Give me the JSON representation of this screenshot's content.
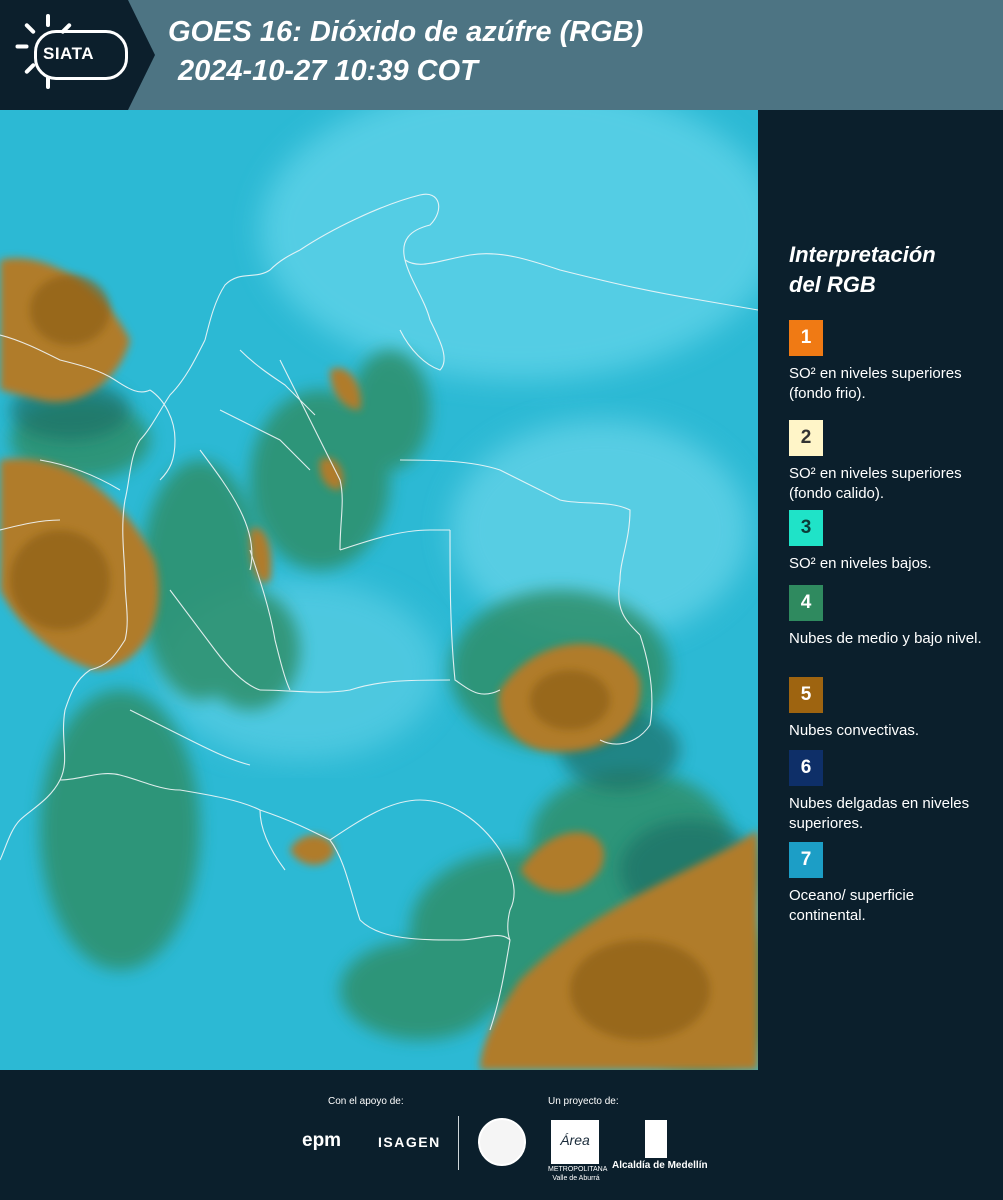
{
  "header": {
    "logo_text": "SIATA",
    "title_line1": "GOES 16: Dióxido de azúfre (RGB)",
    "title_line2": "2024-10-27 10:39 COT"
  },
  "map": {
    "region": "Colombia",
    "icon": "satellite-image"
  },
  "legend": {
    "title_line1": "Interpretación",
    "title_line2": "del RGB",
    "items": [
      {
        "number": "1",
        "color": "#f07a14",
        "text": "SO² en niveles superiores (fondo frio)."
      },
      {
        "number": "2",
        "color": "#fff5c8",
        "text": "SO² en niveles superiores (fondo calido)."
      },
      {
        "number": "3",
        "color": "#1fe3c8",
        "text": "SO² en niveles bajos."
      },
      {
        "number": "4",
        "color": "#2f8a5f",
        "text": "Nubes de medio y bajo nivel."
      },
      {
        "number": "5",
        "color": "#9e6410",
        "text": "Nubes convectivas."
      },
      {
        "number": "6",
        "color": "#0e2f68",
        "text": "Nubes delgadas en niveles superiores."
      },
      {
        "number": "7",
        "color": "#1c9ec6",
        "text": "Oceano/ superficie continental."
      }
    ]
  },
  "footer": {
    "support_label": "Con el apoyo de:",
    "project_label": "Un proyecto de:",
    "epm": "epm",
    "isagen": "ISAGEN",
    "area_logo": "Área",
    "area_sub": "METROPOLITANA Valle de Aburrá",
    "alcaldia": "Alcaldía de Medellín"
  }
}
